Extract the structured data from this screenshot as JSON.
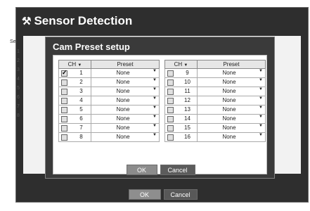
{
  "window": {
    "title": "Sensor Detection",
    "icon": "wrench-icon"
  },
  "background": {
    "header_fragment": "Sen",
    "numbers": [
      "1",
      "2",
      "3",
      "4",
      "5",
      "6",
      "7",
      "8"
    ]
  },
  "dialog": {
    "title": "Cam Preset setup",
    "ch_header": "CH",
    "preset_header": "Preset",
    "left_rows": [
      {
        "ch": "1",
        "preset": "None",
        "checked": true
      },
      {
        "ch": "2",
        "preset": "None",
        "checked": false
      },
      {
        "ch": "3",
        "preset": "None",
        "checked": false
      },
      {
        "ch": "4",
        "preset": "None",
        "checked": false
      },
      {
        "ch": "5",
        "preset": "None",
        "checked": false
      },
      {
        "ch": "6",
        "preset": "None",
        "checked": false
      },
      {
        "ch": "7",
        "preset": "None",
        "checked": false
      },
      {
        "ch": "8",
        "preset": "None",
        "checked": false
      }
    ],
    "right_rows": [
      {
        "ch": "9",
        "preset": "None",
        "checked": false
      },
      {
        "ch": "10",
        "preset": "None",
        "checked": false
      },
      {
        "ch": "11",
        "preset": "None",
        "checked": false
      },
      {
        "ch": "12",
        "preset": "None",
        "checked": false
      },
      {
        "ch": "13",
        "preset": "None",
        "checked": false
      },
      {
        "ch": "14",
        "preset": "None",
        "checked": false
      },
      {
        "ch": "15",
        "preset": "None",
        "checked": false
      },
      {
        "ch": "16",
        "preset": "None",
        "checked": false
      }
    ],
    "ok_label": "OK",
    "cancel_label": "Cancel"
  },
  "footer": {
    "ok_label": "OK",
    "cancel_label": "Cancel"
  }
}
